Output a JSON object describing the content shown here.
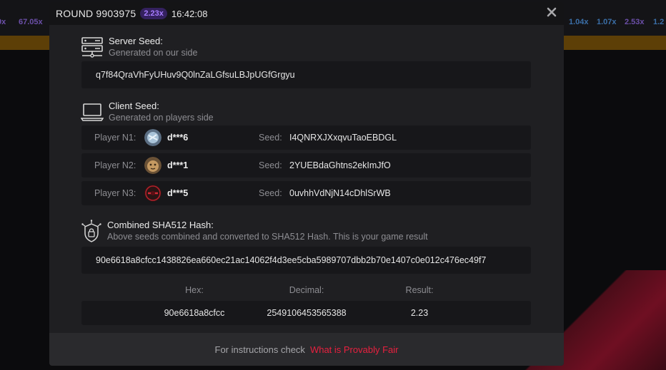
{
  "background": {
    "left_multipliers": [
      "9x",
      "67.05x"
    ],
    "right_multipliers": [
      "1.04x",
      "1.07x",
      "2.53x",
      "1.2"
    ]
  },
  "header": {
    "round_label": "ROUND 9903975",
    "multiplier": "2.23x",
    "time": "16:42:08"
  },
  "server_seed": {
    "title": "Server Seed:",
    "subtitle": "Generated on our side",
    "value": "q7f84QraVhFyUHuv9Q0lnZaLGfsuLBJpUGfGrgyu"
  },
  "client_seed": {
    "title": "Client Seed:",
    "subtitle": "Generated on players side",
    "seed_label": "Seed:",
    "players": [
      {
        "label": "Player N1:",
        "name": "d***6",
        "seed": "I4QNRXJXxqvuTaoEBDGL"
      },
      {
        "label": "Player N2:",
        "name": "d***1",
        "seed": "2YUEBdaGhtns2ekImJfO"
      },
      {
        "label": "Player N3:",
        "name": "d***5",
        "seed": "0uvhhVdNjN14cDhlSrWB"
      }
    ]
  },
  "hash": {
    "title": "Combined SHA512 Hash:",
    "subtitle": "Above seeds combined and converted to SHA512 Hash. This is your game result",
    "value": "90e6618a8cfcc1438826ea660ec21ac14062f4d3ee5cba5989707dbb2b70e1407c0e012c476ec49f7"
  },
  "result": {
    "hex_label": "Hex:",
    "decimal_label": "Decimal:",
    "result_label": "Result:",
    "hex": "90e6618a8cfcc",
    "decimal": "2549106453565388",
    "result": "2.23"
  },
  "footer": {
    "text": "For instructions check",
    "link": "What is Provably Fair"
  },
  "colors": {
    "accent_red": "#e8203f",
    "badge_purple": "#a77cff",
    "modal_bg": "#1f1f22",
    "box_bg": "#17171a"
  }
}
